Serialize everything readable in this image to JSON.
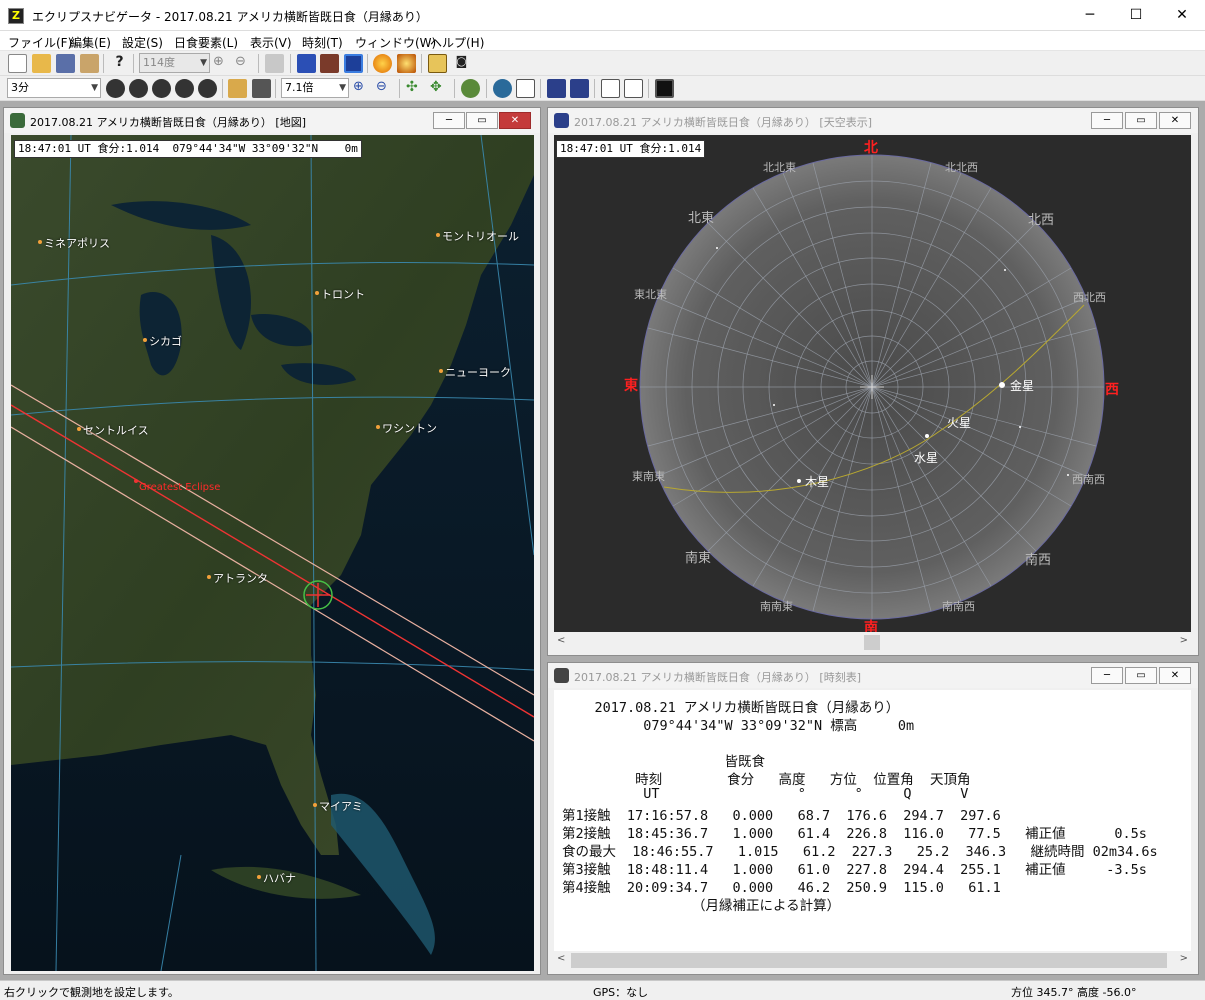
{
  "window": {
    "title": "エクリプスナビゲータ - 2017.08.21 アメリカ横断皆既日食（月縁あり）",
    "minimize": "─",
    "maximize": "☐",
    "close": "✕"
  },
  "menu": [
    "ファイル(F)",
    "編集(E)",
    "設定(S)",
    "日食要素(L)",
    "表示(V)",
    "時刻(T)",
    "ウィンドウ(W)",
    "ヘルプ(H)"
  ],
  "toolbar1": {
    "zoom_combo": "114度"
  },
  "toolbar2": {
    "step_combo": "3分",
    "speed_combo": "7.1倍"
  },
  "map_window": {
    "title": "2017.08.21 アメリカ横断皆既日食（月縁あり） [地図]",
    "hud": "18:47:01 UT 食分:1.014  079°44'34\"W 33°09'32\"N    0m",
    "greatest_eclipse": "Greatest Eclipse",
    "cities": [
      "ミネアポリス",
      "モントリオール",
      "トロント",
      "シカゴ",
      "ニューヨーク",
      "セントルイス",
      "ワシントン",
      "アトランタ",
      "マイアミ",
      "ハバナ"
    ]
  },
  "sky_window": {
    "title": "2017.08.21 アメリカ横断皆既日食（月縁あり） [天空表示]",
    "hud": "18:47:01 UT 食分:1.014",
    "dirs": {
      "n": "北",
      "s": "南",
      "e": "東",
      "w": "西",
      "ne": "北東",
      "nw": "北西",
      "se": "南東",
      "sw": "南西",
      "nne": "北北東",
      "nnw": "北北西",
      "ene": "東北東",
      "wnw": "西北西",
      "ese": "東南東",
      "wsw": "西南西",
      "sse": "南南東",
      "ssw": "南南西"
    },
    "planets": {
      "venus": "金星",
      "mars": "火星",
      "mercury": "水星",
      "jupiter": "木星"
    }
  },
  "time_window": {
    "title": "2017.08.21 アメリカ横断皆既日食（月縁あり） [時刻表]",
    "lines": [
      "    2017.08.21 アメリカ横断皆既日食（月縁あり）",
      "          079°44'34\"W 33°09'32\"N 標高     0m",
      "",
      "                    皆既食",
      "         時刻        食分   高度   方位  位置角  天頂角",
      "          UT                 °      °     Q      V",
      "第1接触  17:16:57.8   0.000   68.7  176.6  294.7  297.6",
      "第2接触  18:45:36.7   1.000   61.4  226.8  116.0   77.5   補正値      0.5s",
      "食の最大  18:46:55.7   1.015   61.2  227.3   25.2  346.3   継続時間 02m34.6s",
      "第3接触  18:48:11.4   1.000   61.0  227.8  294.4  255.1   補正値     -3.5s",
      "第4接触  20:09:34.7   0.000   46.2  250.9  115.0   61.1",
      "                （月縁補正による計算）"
    ]
  },
  "status": {
    "hint": "右クリックで観測地を設定します。",
    "gps": "GPS：なし",
    "azimuth": "方位 345.7° 高度 -56.0°"
  }
}
